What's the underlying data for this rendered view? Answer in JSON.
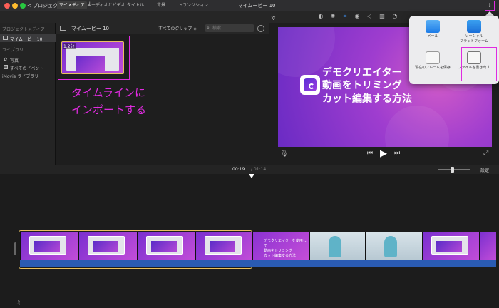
{
  "titlebar": {
    "back_label": "< プロジェクト",
    "window_title": "マイムービー 10",
    "media_icon": "film-grid-icon",
    "import_icon": "download-arrow-icon",
    "share_icon": "share-icon"
  },
  "browser_tabs": [
    {
      "label": "マイメディア",
      "active": true
    },
    {
      "label": "オーディオとビデオ",
      "active": false
    },
    {
      "label": "タイトル",
      "active": false
    },
    {
      "label": "背景",
      "active": false
    },
    {
      "label": "トランジション",
      "active": false
    }
  ],
  "sidebar": {
    "project_media_heading": "プロジェクトメディア",
    "project_item": "マイムービー 10",
    "library_heading": "ライブラリ",
    "items": [
      "写真",
      "すべてのイベント",
      "iMovie ライブラリ"
    ]
  },
  "browser": {
    "project_name": "マイムービー 10",
    "clips_filter": "すべてのクリップ ◇",
    "search_placeholder": "検索",
    "clip_duration": "1.2分"
  },
  "annotation": {
    "line1": "タイムラインに",
    "line2": "インポートする",
    "color": "#e02be0"
  },
  "preview": {
    "line1": "デモクリエイター",
    "line2": "動画をトリミング",
    "line3": "カット編集する方法"
  },
  "share_menu": {
    "items": [
      {
        "label": "メール",
        "icon": "mail-icon"
      },
      {
        "label": "ソーシャル\nプラットフォーム",
        "icon": "social-platform-icon"
      },
      {
        "label": "現在のフレームを保存",
        "icon": "save-frame-icon"
      },
      {
        "label": "ファイルを書き出す",
        "icon": "export-file-icon"
      }
    ]
  },
  "timeline": {
    "current_time": "00:19",
    "total_time": "/ 01:14",
    "settings_label": "設定",
    "title_clip_text": "デモクリエイターを使用して\n動画をトリミング\nカット編集する方法"
  },
  "colors": {
    "highlight": "#e02be0",
    "selection": "#e8c060",
    "audio": "#2a5bb3"
  }
}
